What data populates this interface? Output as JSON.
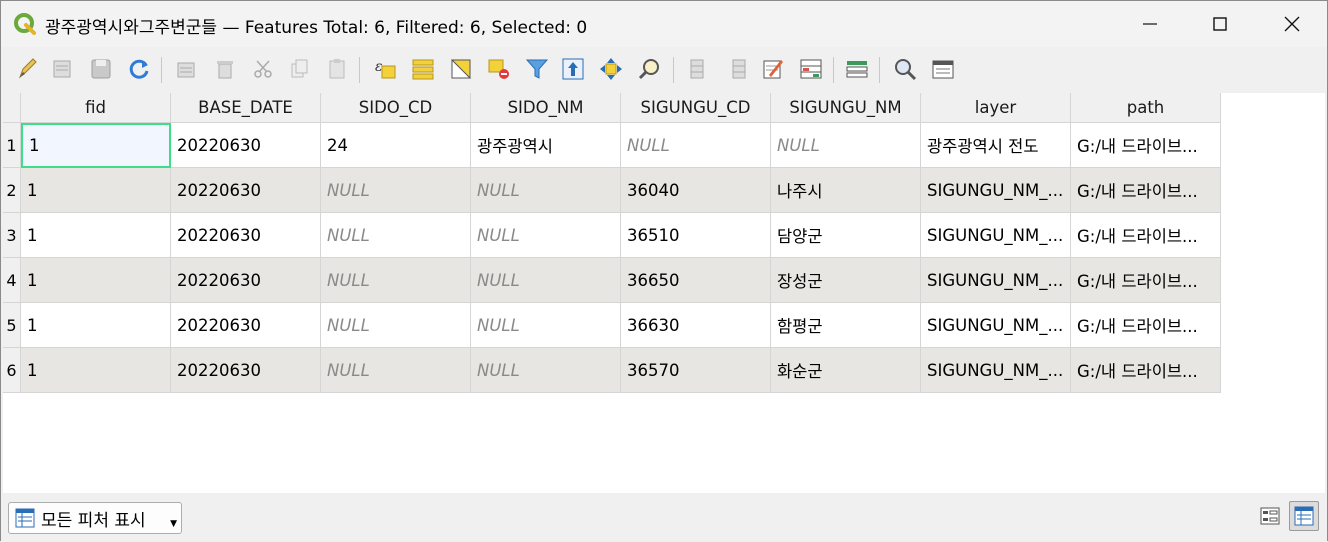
{
  "window": {
    "title": "광주광역시와그주변군들 — Features Total: 6, Filtered: 6, Selected: 0"
  },
  "toolbar": {
    "buttons": [
      "edit-pencil-icon",
      "multi-edit-icon",
      "save-icon",
      "reload-icon",
      "add-feature-icon",
      "delete-feature-icon",
      "cut-icon",
      "copy-icon",
      "paste-icon",
      "expression-select-icon",
      "select-all-icon",
      "invert-selection-icon",
      "deselect-icon",
      "filter-icon",
      "move-selection-top-icon",
      "pan-to-selected-icon",
      "zoom-to-selected-icon",
      "new-field-icon",
      "delete-field-icon",
      "field-calculator-icon",
      "conditional-format-icon",
      "organize-columns-icon",
      "actions-icon",
      "dock-icon"
    ]
  },
  "table": {
    "columns": [
      "fid",
      "BASE_DATE",
      "SIDO_CD",
      "SIDO_NM",
      "SIGUNGU_CD",
      "SIGUNGU_NM",
      "layer",
      "path"
    ],
    "rows": [
      {
        "num": "1",
        "cells": [
          "1",
          "20220630",
          "24",
          "광주광역시",
          "NULL",
          "NULL",
          "광주광역시 전도",
          "G:/내 드라이브..."
        ]
      },
      {
        "num": "2",
        "cells": [
          "1",
          "20220630",
          "NULL",
          "NULL",
          "36040",
          "나주시",
          "SIGUNGU_NM_...",
          "G:/내 드라이브..."
        ]
      },
      {
        "num": "3",
        "cells": [
          "1",
          "20220630",
          "NULL",
          "NULL",
          "36510",
          "담양군",
          "SIGUNGU_NM_...",
          "G:/내 드라이브..."
        ]
      },
      {
        "num": "4",
        "cells": [
          "1",
          "20220630",
          "NULL",
          "NULL",
          "36650",
          "장성군",
          "SIGUNGU_NM_...",
          "G:/내 드라이브..."
        ]
      },
      {
        "num": "5",
        "cells": [
          "1",
          "20220630",
          "NULL",
          "NULL",
          "36630",
          "함평군",
          "SIGUNGU_NM_...",
          "G:/내 드라이브..."
        ]
      },
      {
        "num": "6",
        "cells": [
          "1",
          "20220630",
          "NULL",
          "NULL",
          "36570",
          "화순군",
          "SIGUNGU_NM_...",
          "G:/내 드라이브..."
        ]
      }
    ]
  },
  "bottom": {
    "show_all_label": "모든 피처 표시"
  }
}
